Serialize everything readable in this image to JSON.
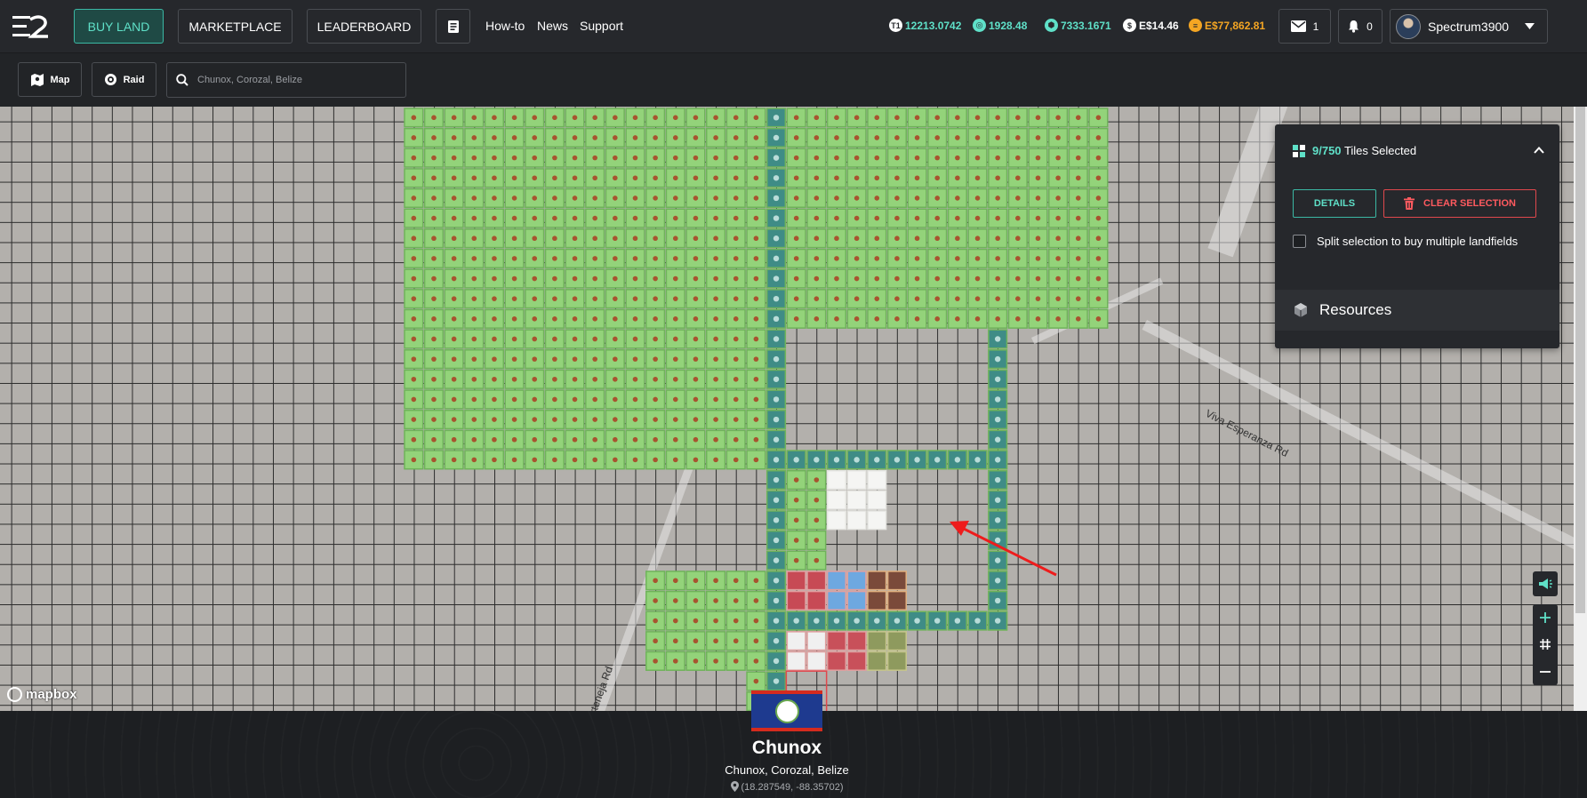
{
  "nav": {
    "buy_land": "BUY LAND",
    "marketplace": "MARKETPLACE",
    "leaderboard": "LEADERBOARD",
    "howto": "How-to",
    "news": "News",
    "support": "Support"
  },
  "wallet": [
    {
      "icon": "tile-token-icon",
      "value": "12213.0742",
      "color": "#5fe0c8"
    },
    {
      "icon": "essence-icon",
      "value": "1928.48",
      "color": "#5fe0c8"
    },
    {
      "icon": "ember-icon",
      "value": "7333.1671",
      "color": "#5fe0c8"
    },
    {
      "icon": "dollar-icon",
      "value": "E$14.46",
      "color": "#ffffff"
    },
    {
      "icon": "coin-icon",
      "value": "E$77,862.81",
      "color": "#f5a623"
    }
  ],
  "inbox": {
    "count": "1"
  },
  "notifications": {
    "count": "0"
  },
  "user": {
    "name": "Spectrum3900"
  },
  "toolbar": {
    "map": "Map",
    "raid": "Raid",
    "search_placeholder": "Chunox, Corozal, Belize"
  },
  "map": {
    "road_label": "Viva Esperanza Rd",
    "road_label_2": "rteneja Rd",
    "attribution": "mapbox"
  },
  "selection": {
    "count": "9/750",
    "label": "Tiles Selected",
    "details": "DETAILS",
    "clear": "CLEAR SELECTION",
    "split": "Split selection to buy multiple landfields",
    "resources": "Resources"
  },
  "location": {
    "name": "Chunox",
    "region": "Chunox, Corozal, Belize",
    "coords": "(18.287549, -88.35702)"
  },
  "colors": {
    "accent": "#5fe0c8",
    "danger": "#ff5a5f",
    "owned_tile": "#93d37a",
    "owned_tile_alt": "#3f8c86",
    "selected_tile": "#f5f5f3"
  }
}
